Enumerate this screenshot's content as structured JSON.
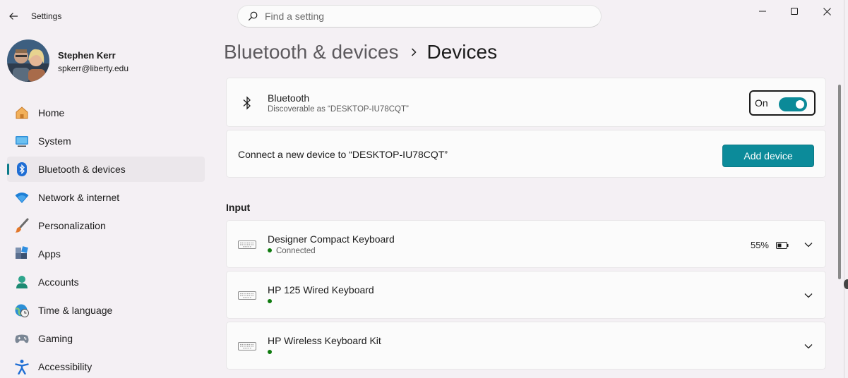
{
  "window": {
    "app_title": "Settings",
    "search_placeholder": "Find a setting"
  },
  "user": {
    "name": "Stephen Kerr",
    "email": "spkerr@liberty.edu"
  },
  "nav": [
    {
      "label": "Home",
      "icon": "home-icon"
    },
    {
      "label": "System",
      "icon": "system-icon"
    },
    {
      "label": "Bluetooth & devices",
      "icon": "bluetooth-icon",
      "active": true
    },
    {
      "label": "Network & internet",
      "icon": "wifi-icon"
    },
    {
      "label": "Personalization",
      "icon": "brush-icon"
    },
    {
      "label": "Apps",
      "icon": "apps-icon"
    },
    {
      "label": "Accounts",
      "icon": "accounts-icon"
    },
    {
      "label": "Time & language",
      "icon": "globe-clock-icon"
    },
    {
      "label": "Gaming",
      "icon": "gamepad-icon"
    },
    {
      "label": "Accessibility",
      "icon": "accessibility-icon"
    }
  ],
  "breadcrumb": {
    "parent": "Bluetooth & devices",
    "current": "Devices"
  },
  "bluetooth": {
    "title": "Bluetooth",
    "subtitle": "Discoverable as “DESKTOP-IU78CQT”",
    "toggle_label": "On",
    "enabled": true
  },
  "connect": {
    "text": "Connect a new device to “DESKTOP-IU78CQT”",
    "button_label": "Add device"
  },
  "input_section": {
    "header": "Input",
    "devices": [
      {
        "name": "Designer Compact Keyboard",
        "status": "Connected",
        "battery": "55%"
      },
      {
        "name": "HP 125 Wired Keyboard",
        "status": ""
      },
      {
        "name": "HP Wireless Keyboard Kit",
        "status": ""
      }
    ]
  },
  "colors": {
    "accent": "#0c8b9a",
    "status_connected": "#0f7b0f"
  }
}
